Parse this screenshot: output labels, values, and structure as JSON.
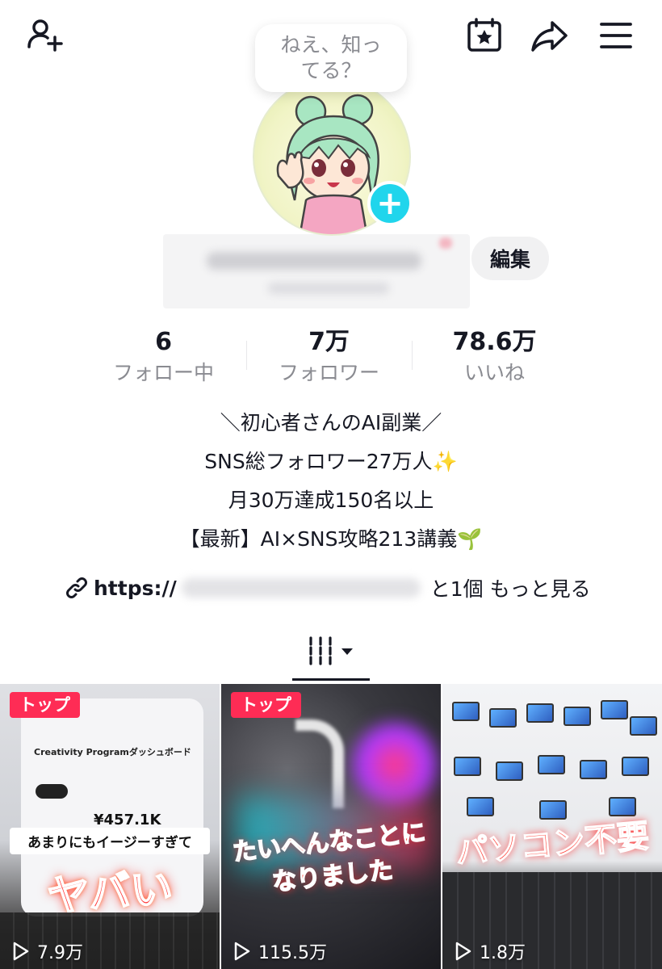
{
  "header": {
    "icons": [
      "add-friend-icon",
      "calendar-star-icon",
      "share-icon",
      "menu-icon"
    ]
  },
  "profile": {
    "bubble_text": "ねえ、知ってる？",
    "edit_label": "編集"
  },
  "stats": [
    {
      "value": "6",
      "label": "フォロー中"
    },
    {
      "value": "7万",
      "label": "フォロワー"
    },
    {
      "value": "78.6万",
      "label": "いいね"
    }
  ],
  "bio": {
    "lines": [
      "＼初心者さんのAI副業／",
      "SNS総フォロワー27万人✨",
      "月30万達成150名以上",
      "【最新】AI×SNS攻略213講義🌱"
    ],
    "link_prefix": "https://",
    "link_more": "と1個 もっと見る"
  },
  "tabs": {
    "active": "grid-icon"
  },
  "videos": [
    {
      "badge": "トップ",
      "views": "7.9万",
      "screen_title": "Creativity Programダッシュボード",
      "screen_amount": "¥457.1K",
      "caption_top": "あまりにもイージーすぎて",
      "caption_main": "ヤバい"
    },
    {
      "badge": "トップ",
      "views": "115.5万",
      "caption_line1": "たいへんなことに",
      "caption_line2": "なりました"
    },
    {
      "views": "1.8万",
      "caption_main": "パソコン不要"
    }
  ],
  "colors": {
    "accent": "#fe2c55",
    "plus": "#20d5ec",
    "text": "#161823",
    "muted": "#8a8b91"
  }
}
